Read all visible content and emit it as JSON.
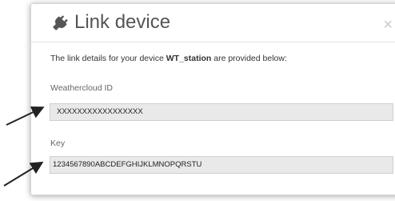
{
  "dialog": {
    "title": "Link device",
    "close_glyph": "×",
    "icon": "plug-icon"
  },
  "intro": {
    "prefix": "The link details for your device ",
    "device_name": "WT_station",
    "suffix": " are provided below:"
  },
  "fields": {
    "weathercloud_id": {
      "label": "Weathercloud ID",
      "value": "XXXXXXXXXXXXXXXXX"
    },
    "key": {
      "label": "Key",
      "value": "1234567890ABCDEFGHIJKLMNOPQRSTU"
    }
  },
  "colors": {
    "title": "#555555",
    "field_bg": "#e9e9e9",
    "arrow": "#222222"
  }
}
